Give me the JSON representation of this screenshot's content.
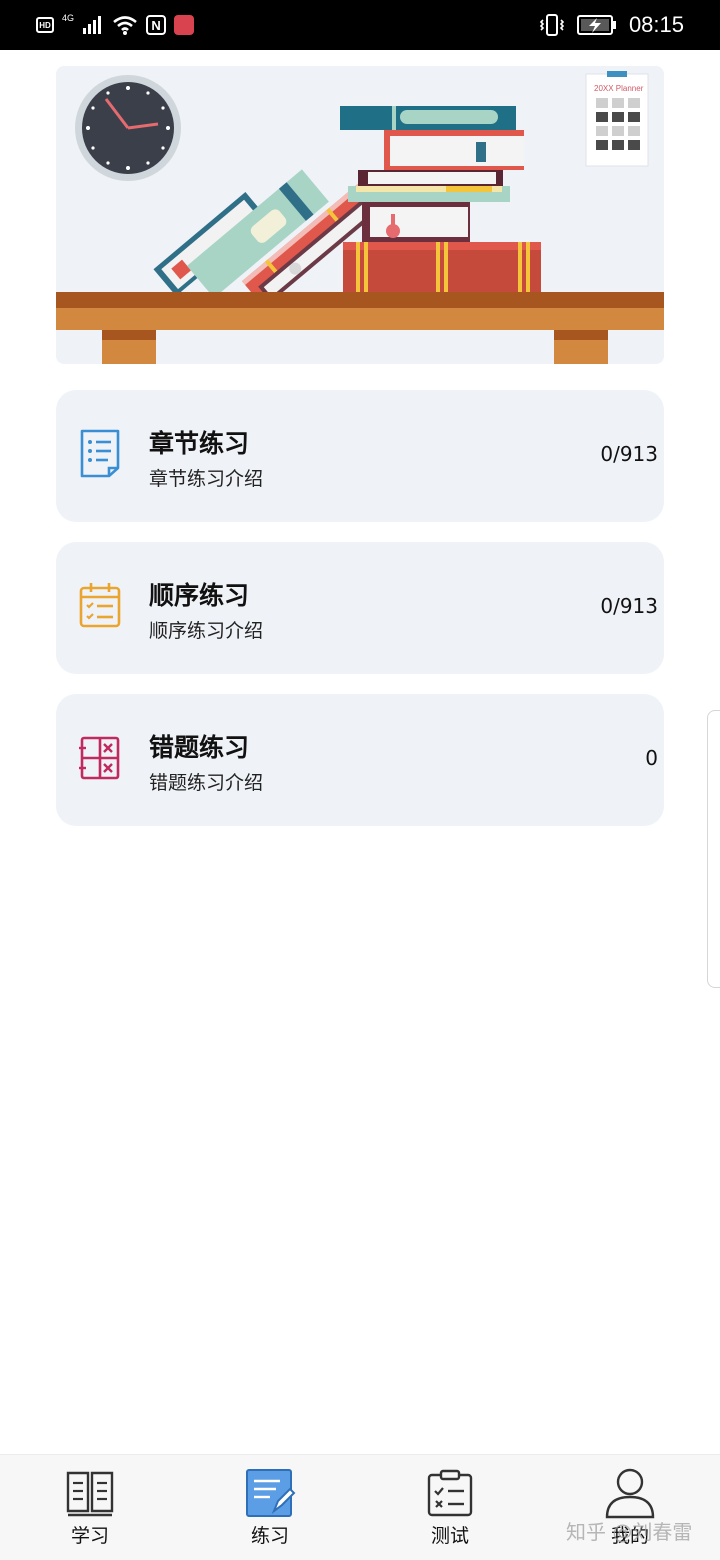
{
  "status_bar": {
    "hd": "HD",
    "network": "4G",
    "nfc": "N",
    "time": "08:15",
    "icons": [
      "hd-icon",
      "signal-icon",
      "wifi-icon",
      "nfc-icon",
      "app-notification-icon",
      "vibrate-icon",
      "battery-charging-icon"
    ]
  },
  "banner": {
    "planner_label": "20XX Planner",
    "icons": [
      "clock-icon",
      "books-icon",
      "planner-icon"
    ]
  },
  "practice_items": [
    {
      "title": "章节练习",
      "subtitle": "章节练习介绍",
      "count": "0/913",
      "icon": "chapter-list-icon",
      "icon_color": "#3a8ed3"
    },
    {
      "title": "顺序练习",
      "subtitle": "顺序练习介绍",
      "count": "0/913",
      "icon": "calendar-checklist-icon",
      "icon_color": "#eaa531"
    },
    {
      "title": "错题练习",
      "subtitle": "错题练习介绍",
      "count": "0",
      "icon": "wrong-answers-icon",
      "icon_color": "#c02a5e"
    }
  ],
  "bottom_nav": {
    "items": [
      {
        "label": "学习",
        "icon": "book-icon",
        "active": false
      },
      {
        "label": "练习",
        "icon": "notebook-pen-icon",
        "active": true
      },
      {
        "label": "测试",
        "icon": "clipboard-check-icon",
        "active": false
      },
      {
        "label": "我的",
        "icon": "user-icon",
        "active": false
      }
    ],
    "active_color": "#3a8ed3"
  },
  "watermark": "知乎 @刘春雷"
}
